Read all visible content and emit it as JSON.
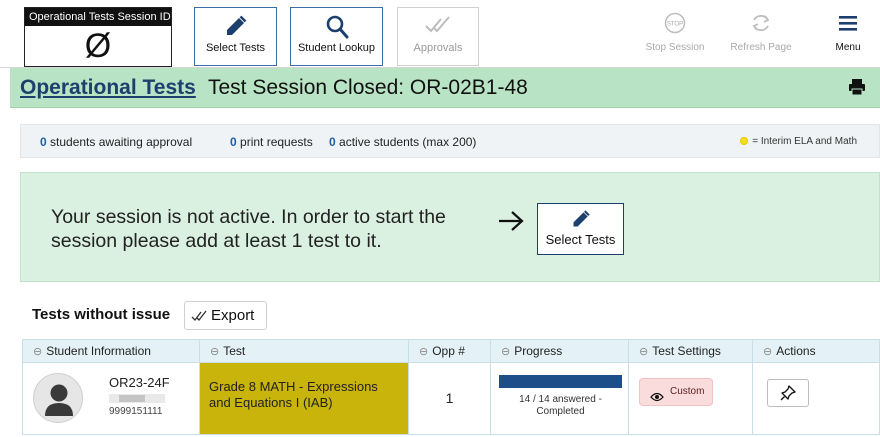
{
  "toolbar": {
    "session_id_label": "Operational Tests Session ID",
    "session_id_value": "Ø",
    "select_tests": "Select Tests",
    "student_lookup": "Student Lookup",
    "approvals": "Approvals",
    "stop_session": "Stop Session",
    "stop_icon_text": "STOP",
    "refresh_page": "Refresh Page",
    "menu": "Menu"
  },
  "title": {
    "link": "Operational Tests",
    "rest": "Test Session Closed: OR-02B1-48"
  },
  "status": {
    "awaiting_count": "0",
    "awaiting_label": "students awaiting approval",
    "print_count": "0",
    "print_label": "print requests",
    "active_count": "0",
    "active_label": "active students (max 200)",
    "legend": "= Interim ELA and Math"
  },
  "notice": {
    "message": "Your session is not active. In order to start the session please add at least 1 test to it.",
    "button": "Select Tests"
  },
  "tests": {
    "heading": "Tests without issue",
    "export": "Export",
    "columns": [
      "Student Information",
      "Test",
      "Opp #",
      "Progress",
      "Test Settings",
      "Actions"
    ],
    "rows": [
      {
        "student_id": "OR23-24Fa",
        "student_number": "9999151111",
        "test_name": "Grade 8 MATH - Expressions and Equations I (IAB)",
        "opp": "1",
        "progress_fraction": 1.0,
        "progress_text": "14 / 14 answered  -  Completed",
        "settings": "Custom"
      }
    ]
  },
  "colors": {
    "title_bg": "#b8e3c4",
    "notice_bg": "#daf0e0",
    "test_cell_bg": "#c8b40a",
    "accent": "#1d3f6e",
    "progress": "#1d4e89",
    "settings_bg": "#fbdcdc"
  }
}
